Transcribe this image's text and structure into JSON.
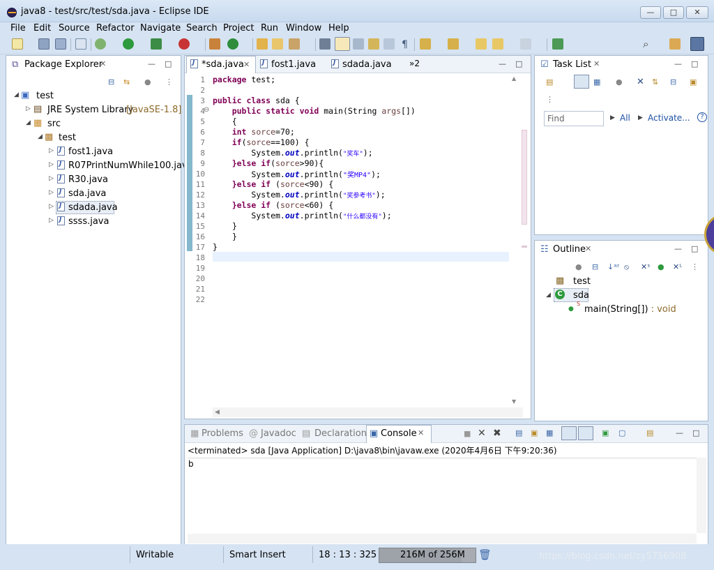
{
  "window": {
    "title": "java8 - test/src/test/sda.java - Eclipse IDE",
    "min": "—",
    "max": "□",
    "close": "✕"
  },
  "menu": [
    "File",
    "Edit",
    "Source",
    "Refactor",
    "Navigate",
    "Search",
    "Project",
    "Run",
    "Window",
    "Help"
  ],
  "package_explorer": {
    "tab_label": "Package Explorer",
    "tree": [
      {
        "label": "test",
        "extra": ""
      },
      {
        "label": "JRE System Library",
        "extra": "[JavaSE-1.8]"
      },
      {
        "label": "src",
        "extra": ""
      },
      {
        "label": "test",
        "extra": ""
      },
      {
        "label": "fost1.java",
        "extra": ""
      },
      {
        "label": "R07PrintNumWhile100.java",
        "extra": ""
      },
      {
        "label": "R30.java",
        "extra": ""
      },
      {
        "label": "sda.java",
        "extra": ""
      },
      {
        "label": "sdada.java",
        "extra": ""
      },
      {
        "label": "ssss.java",
        "extra": ""
      }
    ]
  },
  "editor": {
    "tabs": [
      "*sda.java",
      "fost1.java",
      "sdada.java"
    ],
    "overflow": "»2",
    "line_numbers": [
      "1",
      "2",
      "3",
      "4",
      "5",
      "6",
      "7",
      "8",
      "9",
      "10",
      "11",
      "12",
      "13",
      "14",
      "15",
      "16",
      "17",
      "18",
      "19",
      "20",
      "21",
      "22"
    ],
    "code": {
      "l1_kw": "package",
      "l1_rest": " test;",
      "l3_kw": "public class",
      "l3_rest": " sda {",
      "l4_kw": "public static void",
      "l4_rest": " main(String ",
      "l4_var": "args",
      "l4_end": "[])",
      "l5": "    {",
      "l6_kw": "int",
      "l6_var": "sorce",
      "l6_rest": "=70;",
      "l7_kw": "if",
      "l7_var": "sorce",
      "l7_rest": "==100) {",
      "sys": "System.",
      "out": "out",
      "println": ".println(",
      "l8_str": "\"奖车\"",
      "l10_str": "\"奖MP4\"",
      "l12_str": "\"奖参考书\"",
      "l14_str": "\"什么都没有\"",
      "end_paren": ");",
      "l9_kw1": "}else if",
      "l9_rest": ">90){",
      "l11_kw": "}else if",
      "l11_rest": " (",
      "l11_rest2": "<90) {",
      "l13_kw": "}else if",
      "l13_rest2": "<60) {",
      "brace": "}"
    }
  },
  "task_list": {
    "tab_label": "Task List",
    "find_placeholder": "Find",
    "all": "All",
    "activate": "Activate...",
    "help": "?"
  },
  "outline": {
    "tab_label": "Outline",
    "items": [
      {
        "label": "test"
      },
      {
        "label": "sda"
      },
      {
        "label": "main(String[])",
        "type": " : void"
      }
    ]
  },
  "bottom": {
    "tabs": [
      "Problems",
      "Javadoc",
      "Declaration",
      "Console"
    ],
    "console_header": "<terminated> sda [Java Application] D:\\java8\\bin\\javaw.exe (2020年4月6日 下午9:20:36)",
    "console_output": "b"
  },
  "status": {
    "writable": "Writable",
    "insert": "Smart Insert",
    "position": "18 : 13 : 325",
    "memory": "216M of 256M",
    "watermark": "https://blog.csdn.net/zy5756908"
  },
  "colors": {
    "accent": "#d6e3f2",
    "keyword": "#7f0055",
    "string": "#2a00ff"
  }
}
